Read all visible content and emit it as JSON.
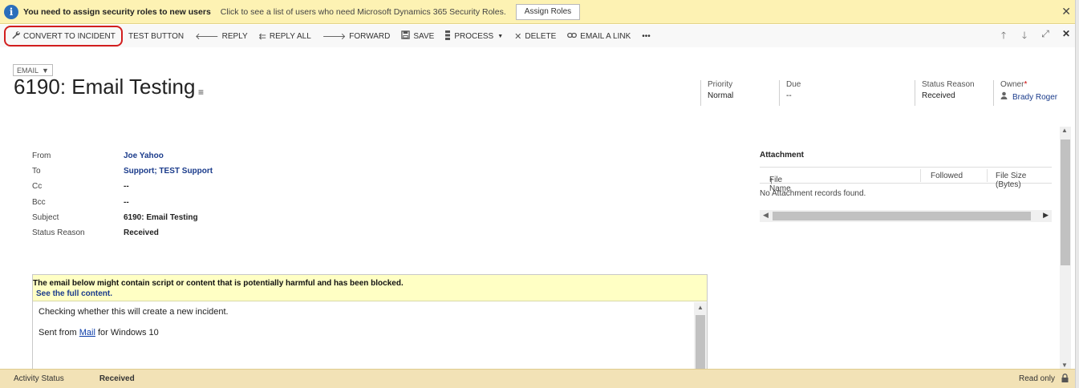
{
  "notification": {
    "title": "You need to assign security roles to new users",
    "description": "Click to see a list of users who need Microsoft Dynamics 365 Security Roles.",
    "button": "Assign Roles",
    "close": "✕"
  },
  "commands": {
    "convert": "CONVERT TO INCIDENT",
    "test": "TEST BUTTON",
    "reply": "REPLY",
    "reply_all": "REPLY ALL",
    "forward": "FORWARD",
    "save": "SAVE",
    "process": "PROCESS",
    "delete": "DELETE",
    "email_link": "EMAIL A LINK",
    "more": "•••"
  },
  "header": {
    "entity": "EMAIL",
    "title": "6190: Email Testing",
    "priority_label": "Priority",
    "priority_value": "Normal",
    "due_label": "Due",
    "due_value": "--",
    "status_label": "Status Reason",
    "status_value": "Received",
    "owner_label": "Owner",
    "owner_required": "*",
    "owner_value": "Brady Roger"
  },
  "fields": [
    {
      "label": "From",
      "value": "Joe Yahoo"
    },
    {
      "label": "To",
      "value": "Support; TEST Support"
    },
    {
      "label": "Cc",
      "value": "--"
    },
    {
      "label": "Bcc",
      "value": "--"
    },
    {
      "label": "Subject",
      "value": "6190: Email Testing"
    },
    {
      "label": "Status Reason",
      "value": "Received"
    }
  ],
  "attachments": {
    "title": "Attachment",
    "col_file": "File Name",
    "col_followed": "Followed",
    "col_size": "File Size (Bytes)",
    "empty": "No Attachment records found."
  },
  "email": {
    "warning": "The email below might contain script or content that is potentially harmful and has been blocked.",
    "see_full": "See the full content.",
    "line1": "Checking whether this will create a new incident.",
    "sent_prefix": "Sent from ",
    "sent_link": "Mail",
    "sent_suffix": " for Windows 10"
  },
  "footer": {
    "status_label": "Activity Status",
    "status_value": "Received",
    "mode": "Read only"
  },
  "colors": {
    "notification_bg": "#fdf2b3",
    "highlight_border": "#d21e1e",
    "link": "#1a3b8b",
    "footer_bg": "#f2e2b6"
  }
}
